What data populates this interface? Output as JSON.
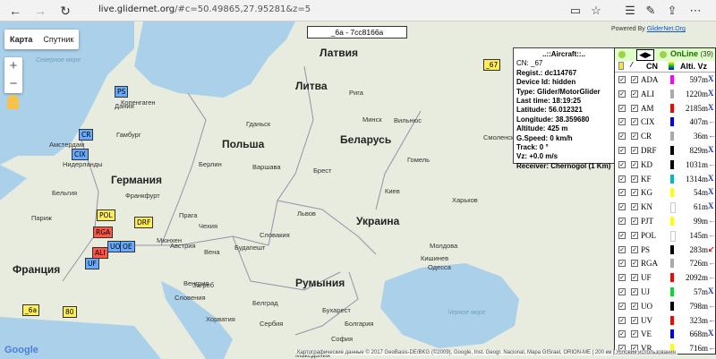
{
  "browser": {
    "url_host": "live.glidernet.org",
    "url_rest": "/#c=50.49865,27.95281&z=5",
    "icons": [
      "back-icon",
      "forward-icon",
      "refresh-icon",
      "reader-icon",
      "favorite-icon",
      "hub-icon",
      "notes-icon",
      "share-icon",
      "more-icon"
    ]
  },
  "map": {
    "type_buttons": [
      "Карта",
      "Спутник"
    ],
    "selected_type": "Карта",
    "zoom_in": "+",
    "zoom_out": "−",
    "title": "_6a - 7cc8166a",
    "powered_by": "Powered By",
    "powered_link": "GliderNet.Org",
    "labels": [
      {
        "t": "Латвия",
        "k": "country"
      },
      {
        "t": "Литва",
        "k": "country"
      },
      {
        "t": "Беларусь",
        "k": "country"
      },
      {
        "t": "Польша",
        "k": "country"
      },
      {
        "t": "Германия",
        "k": "country"
      },
      {
        "t": "Франция",
        "k": "country"
      },
      {
        "t": "Украина",
        "k": "country"
      },
      {
        "t": "Румыния",
        "k": "country"
      },
      {
        "t": "Австрия",
        "k": "city"
      },
      {
        "t": "Венгрия",
        "k": "city"
      },
      {
        "t": "Чехия",
        "k": "city"
      },
      {
        "t": "Словакия",
        "k": "city"
      },
      {
        "t": "Молдова",
        "k": "city"
      },
      {
        "t": "Бельгия",
        "k": "city"
      },
      {
        "t": "Нидерланды",
        "k": "city"
      },
      {
        "t": "Дания",
        "k": "city"
      },
      {
        "t": "Словения",
        "k": "city"
      },
      {
        "t": "Хорватия",
        "k": "city"
      },
      {
        "t": "Сербия",
        "k": "city"
      },
      {
        "t": "Болгария",
        "k": "city"
      },
      {
        "t": "Македония",
        "k": "city"
      },
      {
        "t": "Северное море",
        "k": "sea"
      },
      {
        "t": "Черное море",
        "k": "sea"
      },
      {
        "t": "Копенгаген",
        "k": "city"
      },
      {
        "t": "Гамбург",
        "k": "city"
      },
      {
        "t": "Берлин",
        "k": "city"
      },
      {
        "t": "Варшава",
        "k": "city"
      },
      {
        "t": "Минск",
        "k": "city"
      },
      {
        "t": "Вильнюс",
        "k": "city"
      },
      {
        "t": "Рига",
        "k": "city"
      },
      {
        "t": "Киев",
        "k": "city"
      },
      {
        "t": "Харьков",
        "k": "city"
      },
      {
        "t": "Прага",
        "k": "city"
      },
      {
        "t": "Вена",
        "k": "city"
      },
      {
        "t": "Будапешт",
        "k": "city"
      },
      {
        "t": "Бухарест",
        "k": "city"
      },
      {
        "t": "Мюнхен",
        "k": "city"
      },
      {
        "t": "Париж",
        "k": "city"
      },
      {
        "t": "Амстердам",
        "k": "city"
      },
      {
        "t": "Франкфурт",
        "k": "city"
      },
      {
        "t": "Кишинев",
        "k": "city"
      },
      {
        "t": "Одесса",
        "k": "city"
      },
      {
        "t": "Смоленск",
        "k": "city"
      },
      {
        "t": "Гомель",
        "k": "city"
      },
      {
        "t": "Брест",
        "k": "city"
      },
      {
        "t": "Львов",
        "k": "city"
      },
      {
        "t": "Гданьск",
        "k": "city"
      },
      {
        "t": "Белград",
        "k": "city"
      },
      {
        "t": "София",
        "k": "city"
      },
      {
        "t": "Загреб",
        "k": "city"
      }
    ],
    "markers": [
      {
        "t": "_67",
        "c": "#ffee55"
      },
      {
        "t": "PS",
        "c": "#66aaff"
      },
      {
        "t": "POL",
        "c": "#ffee55"
      },
      {
        "t": "DRF",
        "c": "#ffee55"
      },
      {
        "t": "RGA",
        "c": "#ff5544"
      },
      {
        "t": "CR",
        "c": "#66aaff"
      },
      {
        "t": "UO",
        "c": "#66aaff"
      },
      {
        "t": "CIX",
        "c": "#66aaff"
      },
      {
        "t": "ALI",
        "c": "#ff5544"
      },
      {
        "t": "UF",
        "c": "#66aaff"
      },
      {
        "t": "_6a",
        "c": "#ffee55"
      },
      {
        "t": "80",
        "c": "#ffee55"
      },
      {
        "t": "OE",
        "c": "#66aaff"
      }
    ],
    "copyright": "Картографические данные © 2017 GeoBasis-DE/BKG (©2009), Google, Inst. Geogr. Nacional, Mapa GISrael, ORION-ME | 200 км | Условия использования",
    "google_logo": "Google"
  },
  "infobox": {
    "header": "..::Aircraft::..",
    "lines": [
      "CN: _67",
      "Regist.: dc114767",
      "Device Id: hidden",
      "Type: Glider/MotorGlider",
      "Last time: 18:19:25",
      "Latitude: 56.012321",
      "Longitude: 38.359680",
      "Altitude: 425 m",
      "G.Speed: 0 km/h",
      "Track: 0 °",
      "Vz: +0.0 m/s",
      "Receiver: Chernogol (1 Km)"
    ]
  },
  "panel": {
    "online_label": "OnLine",
    "online_count": "(39)",
    "col_cn": "CN",
    "col_alt": "Alti. Vz",
    "rows": [
      {
        "cn": "ADA",
        "alt": "597m",
        "color": "#ff00ff",
        "vz": "X",
        "vzc": "#1a37c8"
      },
      {
        "cn": "ALI",
        "alt": "1220m",
        "color": "#aaaaaa",
        "vz": "X",
        "vzc": "#1a37c8"
      },
      {
        "cn": "AM",
        "alt": "2185m",
        "color": "#ff0000",
        "vz": "X",
        "vzc": "#1a37c8"
      },
      {
        "cn": "CIX",
        "alt": "407m",
        "color": "#0000ff",
        "vz": "←",
        "vzc": "#2d9a2d"
      },
      {
        "cn": "CR",
        "alt": "36m",
        "color": "#aaaaaa",
        "vz": "←",
        "vzc": "#1a37c8"
      },
      {
        "cn": "DRF",
        "alt": "829m",
        "color": "#000000",
        "vz": "X",
        "vzc": "#1a37c8"
      },
      {
        "cn": "KD",
        "alt": "1031m",
        "color": "#000000",
        "vz": "←",
        "vzc": "#2d9a2d"
      },
      {
        "cn": "KF",
        "alt": "1314m",
        "color": "#00bbcc",
        "vz": "X",
        "vzc": "#1a37c8"
      },
      {
        "cn": "KG",
        "alt": "54m",
        "color": "#ffff00",
        "vz": "X",
        "vzc": "#1a37c8"
      },
      {
        "cn": "KN",
        "alt": "61m",
        "color": "#ffffff",
        "vz": "X",
        "vzc": "#1a37c8"
      },
      {
        "cn": "PJT",
        "alt": "99m",
        "color": "#ffff00",
        "vz": "←",
        "vzc": "#2d9a2d"
      },
      {
        "cn": "POL",
        "alt": "145m",
        "color": "#ffffff",
        "vz": "←",
        "vzc": "#2d9a2d"
      },
      {
        "cn": "PS",
        "alt": "283m",
        "color": "#000000",
        "vz": "↙",
        "vzc": "#cc2222"
      },
      {
        "cn": "RGA",
        "alt": "726m",
        "color": "#aaaaaa",
        "vz": "←",
        "vzc": "#2d9a2d"
      },
      {
        "cn": "UF",
        "alt": "2092m",
        "color": "#ff0000",
        "vz": "←",
        "vzc": "#2d9a2d"
      },
      {
        "cn": "UJ",
        "alt": "57m",
        "color": "#00dd33",
        "vz": "X",
        "vzc": "#1a37c8"
      },
      {
        "cn": "UO",
        "alt": "798m",
        "color": "#000000",
        "vz": "←",
        "vzc": "#2d9a2d"
      },
      {
        "cn": "UV",
        "alt": "323m",
        "color": "#ff0000",
        "vz": "←",
        "vzc": "#1a37c8"
      },
      {
        "cn": "VE",
        "alt": "668m",
        "color": "#0000ff",
        "vz": "X",
        "vzc": "#1a37c8"
      },
      {
        "cn": "VR",
        "alt": "716m",
        "color": "#ffff00",
        "vz": "←",
        "vzc": "#1a37c8"
      }
    ]
  }
}
